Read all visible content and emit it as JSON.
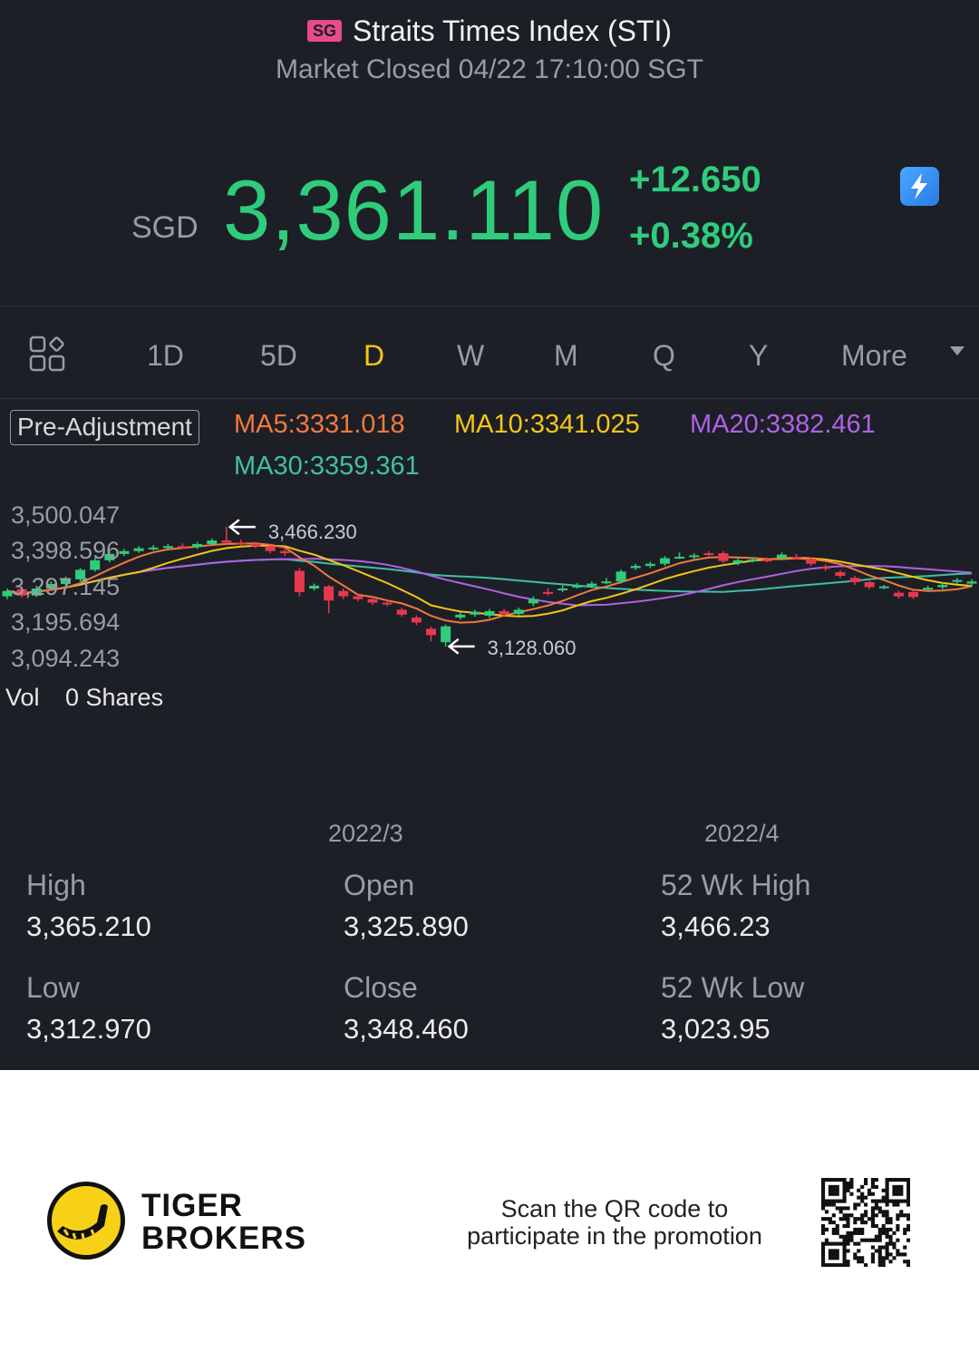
{
  "header": {
    "region_badge": "SG",
    "index_name": "Straits Times Index (STI)",
    "market_status": "Market Closed 04/22 17:10:00 SGT"
  },
  "quote": {
    "currency": "SGD",
    "last_price": "3,361.110",
    "change": "+12.650",
    "change_pct": "+0.38%",
    "flash_icon": "lightning-icon"
  },
  "colors": {
    "up": "#2fcc7c",
    "down": "#e8384f",
    "active_tab": "#f5c518",
    "ma5": "#f07a3c",
    "ma10": "#f5c518",
    "ma20": "#b061e8",
    "ma30": "#3fbfa8",
    "background": "#1d1f26"
  },
  "tabs": {
    "items": [
      {
        "label": "1D"
      },
      {
        "label": "5D"
      },
      {
        "label": "D"
      },
      {
        "label": "W"
      },
      {
        "label": "M"
      },
      {
        "label": "Q"
      },
      {
        "label": "Y"
      },
      {
        "label": "More"
      }
    ],
    "active": "D"
  },
  "indicators": {
    "pre_adjustment": "Pre-Adjustment",
    "ma5": "MA5:3331.018",
    "ma10": "MA10:3341.025",
    "ma20": "MA20:3382.461",
    "ma30": "MA30:3359.361"
  },
  "chart_data": {
    "type": "candlestick",
    "y_axis_ticks": [
      "3,500.047",
      "3,398.596",
      "3,297.145",
      "3,195.694",
      "3,094.243"
    ],
    "ylim": [
      3094.243,
      3500.047
    ],
    "x_axis_ticks": [
      "2022/3",
      "2022/4"
    ],
    "high_annotation": "3,466.230",
    "low_annotation": "3,128.060",
    "candles": [
      {
        "o": 3270,
        "c": 3285,
        "h": 3292,
        "l": 3262
      },
      {
        "o": 3290,
        "c": 3272,
        "h": 3298,
        "l": 3266
      },
      {
        "o": 3272,
        "c": 3292,
        "h": 3300,
        "l": 3268
      },
      {
        "o": 3292,
        "c": 3305,
        "h": 3312,
        "l": 3288
      },
      {
        "o": 3305,
        "c": 3320,
        "h": 3326,
        "l": 3300
      },
      {
        "o": 3318,
        "c": 3345,
        "h": 3350,
        "l": 3312
      },
      {
        "o": 3345,
        "c": 3372,
        "h": 3380,
        "l": 3340
      },
      {
        "o": 3372,
        "c": 3390,
        "h": 3396,
        "l": 3366
      },
      {
        "o": 3390,
        "c": 3398,
        "h": 3404,
        "l": 3384
      },
      {
        "o": 3398,
        "c": 3406,
        "h": 3412,
        "l": 3393
      },
      {
        "o": 3406,
        "c": 3408,
        "h": 3415,
        "l": 3400
      },
      {
        "o": 3408,
        "c": 3412,
        "h": 3418,
        "l": 3402
      },
      {
        "o": 3412,
        "c": 3410,
        "h": 3420,
        "l": 3404
      },
      {
        "o": 3410,
        "c": 3418,
        "h": 3424,
        "l": 3404
      },
      {
        "o": 3418,
        "c": 3428,
        "h": 3434,
        "l": 3414
      },
      {
        "o": 3428,
        "c": 3422,
        "h": 3466.23,
        "l": 3416
      },
      {
        "o": 3422,
        "c": 3418,
        "h": 3430,
        "l": 3412
      },
      {
        "o": 3418,
        "c": 3412,
        "h": 3424,
        "l": 3406
      },
      {
        "o": 3412,
        "c": 3398,
        "h": 3416,
        "l": 3392
      },
      {
        "o": 3398,
        "c": 3392,
        "h": 3404,
        "l": 3384
      },
      {
        "o": 3342,
        "c": 3282,
        "h": 3350,
        "l": 3270
      },
      {
        "o": 3292,
        "c": 3300,
        "h": 3306,
        "l": 3286
      },
      {
        "o": 3298,
        "c": 3258,
        "h": 3302,
        "l": 3222
      },
      {
        "o": 3285,
        "c": 3270,
        "h": 3292,
        "l": 3262
      },
      {
        "o": 3270,
        "c": 3262,
        "h": 3276,
        "l": 3256
      },
      {
        "o": 3262,
        "c": 3252,
        "h": 3268,
        "l": 3246
      },
      {
        "o": 3252,
        "c": 3248,
        "h": 3258,
        "l": 3242
      },
      {
        "o": 3232,
        "c": 3218,
        "h": 3238,
        "l": 3212
      },
      {
        "o": 3210,
        "c": 3196,
        "h": 3216,
        "l": 3188
      },
      {
        "o": 3178,
        "c": 3160,
        "h": 3184,
        "l": 3142
      },
      {
        "o": 3140,
        "c": 3185,
        "h": 3190,
        "l": 3128.06
      },
      {
        "o": 3210,
        "c": 3218,
        "h": 3224,
        "l": 3204
      },
      {
        "o": 3218,
        "c": 3226,
        "h": 3232,
        "l": 3212
      },
      {
        "o": 3215,
        "c": 3228,
        "h": 3234,
        "l": 3209
      },
      {
        "o": 3228,
        "c": 3220,
        "h": 3234,
        "l": 3214
      },
      {
        "o": 3220,
        "c": 3232,
        "h": 3238,
        "l": 3214
      },
      {
        "o": 3250,
        "c": 3262,
        "h": 3270,
        "l": 3242
      },
      {
        "o": 3282,
        "c": 3278,
        "h": 3292,
        "l": 3272
      },
      {
        "o": 3288,
        "c": 3292,
        "h": 3300,
        "l": 3282
      },
      {
        "o": 3300,
        "c": 3300,
        "h": 3308,
        "l": 3292
      },
      {
        "o": 3300,
        "c": 3306,
        "h": 3312,
        "l": 3294
      },
      {
        "o": 3312,
        "c": 3312,
        "h": 3322,
        "l": 3304
      },
      {
        "o": 3312,
        "c": 3340,
        "h": 3346,
        "l": 3306
      },
      {
        "o": 3350,
        "c": 3356,
        "h": 3362,
        "l": 3344
      },
      {
        "o": 3356,
        "c": 3362,
        "h": 3368,
        "l": 3350
      },
      {
        "o": 3362,
        "c": 3378,
        "h": 3384,
        "l": 3356
      },
      {
        "o": 3382,
        "c": 3382,
        "h": 3394,
        "l": 3376
      },
      {
        "o": 3382,
        "c": 3386,
        "h": 3392,
        "l": 3376
      },
      {
        "o": 3392,
        "c": 3390,
        "h": 3398,
        "l": 3384
      },
      {
        "o": 3392,
        "c": 3370,
        "h": 3398,
        "l": 3364
      },
      {
        "o": 3364,
        "c": 3372,
        "h": 3380,
        "l": 3358
      },
      {
        "o": 3372,
        "c": 3374,
        "h": 3380,
        "l": 3366
      },
      {
        "o": 3374,
        "c": 3372,
        "h": 3380,
        "l": 3366
      },
      {
        "o": 3378,
        "c": 3388,
        "h": 3394,
        "l": 3372
      },
      {
        "o": 3382,
        "c": 3380,
        "h": 3390,
        "l": 3374
      },
      {
        "o": 3376,
        "c": 3362,
        "h": 3380,
        "l": 3356
      },
      {
        "o": 3354,
        "c": 3348,
        "h": 3360,
        "l": 3342
      },
      {
        "o": 3338,
        "c": 3328,
        "h": 3344,
        "l": 3322
      },
      {
        "o": 3322,
        "c": 3310,
        "h": 3328,
        "l": 3302
      },
      {
        "o": 3310,
        "c": 3296,
        "h": 3314,
        "l": 3290
      },
      {
        "o": 3296,
        "c": 3298,
        "h": 3302,
        "l": 3290
      },
      {
        "o": 3280,
        "c": 3270,
        "h": 3286,
        "l": 3264
      },
      {
        "o": 3282,
        "c": 3268,
        "h": 3288,
        "l": 3262
      },
      {
        "o": 3292,
        "c": 3294,
        "h": 3300,
        "l": 3286
      },
      {
        "o": 3296,
        "c": 3302,
        "h": 3310,
        "l": 3290
      },
      {
        "o": 3312,
        "c": 3316,
        "h": 3322,
        "l": 3306
      },
      {
        "o": 3306,
        "c": 3312,
        "h": 3318,
        "l": 3296
      }
    ]
  },
  "volume": {
    "label": "Vol",
    "value": "0 Shares"
  },
  "stats": {
    "high_label": "High",
    "high_value": "3,365.210",
    "open_label": "Open",
    "open_value": "3,325.890",
    "wk52_high_label": "52 Wk High",
    "wk52_high_value": "3,466.23",
    "low_label": "Low",
    "low_value": "3,312.970",
    "close_label": "Close",
    "close_value": "3,348.460",
    "wk52_low_label": "52 Wk Low",
    "wk52_low_value": "3,023.95"
  },
  "footer": {
    "brand_line1": "TIGER",
    "brand_line2": "BROKERS",
    "promo_line1": "Scan the QR code to",
    "promo_line2": "participate in the promotion",
    "logo_icon": "tiger-logo-icon",
    "qr_icon": "qr-code-icon"
  }
}
